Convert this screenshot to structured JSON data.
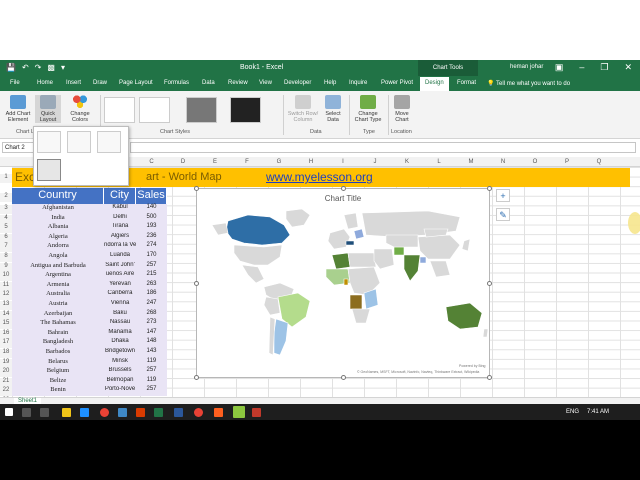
{
  "window": {
    "title": "Book1 - Excel",
    "context_tab": "Chart Tools",
    "user": "heman johar"
  },
  "tabs": [
    "File",
    "Home",
    "Insert",
    "Draw",
    "Page Layout",
    "Formulas",
    "Data",
    "Review",
    "View",
    "Developer",
    "Help",
    "Inquire",
    "Power Pivot",
    "Design",
    "Format"
  ],
  "active_tab": "Design",
  "tell_me": "Tell me what you want to do",
  "ribbon": {
    "add_chart_element": "Add Chart Element",
    "quick_layout": "Quick Layout",
    "change_colors": "Change Colors",
    "chart_layouts_group": "Chart La",
    "chart_styles_group": "Chart Styles",
    "switch_row_col": "Switch Row/ Column",
    "select_data": "Select Data",
    "data_group": "Data",
    "change_chart_type": "Change Chart Type",
    "type_group": "Type",
    "move_chart": "Move Chart",
    "location_group": "Location"
  },
  "name_box": "Chart 2",
  "columns": [
    "A",
    "B",
    "C",
    "D",
    "E",
    "F",
    "G",
    "H",
    "I",
    "J",
    "K",
    "L",
    "M",
    "N",
    "O",
    "P",
    "Q"
  ],
  "rows": [
    "1",
    "2",
    "3",
    "4",
    "5",
    "6",
    "7",
    "8",
    "9",
    "10",
    "11",
    "12",
    "13",
    "14",
    "15",
    "16",
    "17",
    "18",
    "19",
    "20",
    "21",
    "22",
    "23"
  ],
  "banner": {
    "text_left": "Exc",
    "text_right": "art - World Map",
    "link": "www.myelesson.org"
  },
  "table": {
    "headers": [
      "Country",
      "City",
      "Sales"
    ],
    "rows": [
      [
        "Afghanistan",
        "Kabul",
        "140"
      ],
      [
        "India",
        "Delhi",
        "500"
      ],
      [
        "Albania",
        "Tirana",
        "193"
      ],
      [
        "Algeria",
        "Algiers",
        "236"
      ],
      [
        "Andorra",
        "ndorra la Ve",
        "274"
      ],
      [
        "Angola",
        "Luanda",
        "170"
      ],
      [
        "Antigua and Barbuda",
        "Saint John'",
        "257"
      ],
      [
        "Argentina",
        "uenos Aire",
        "215"
      ],
      [
        "Armenia",
        "Yerevan",
        "263"
      ],
      [
        "Australia",
        "Canberra",
        "186"
      ],
      [
        "Austria",
        "Vienna",
        "247"
      ],
      [
        "Azerbaijan",
        "Baku",
        "268"
      ],
      [
        "The Bahamas",
        "Nassau",
        "273"
      ],
      [
        "Bahrain",
        "Manama",
        "147"
      ],
      [
        "Bangladesh",
        "Dhaka",
        "148"
      ],
      [
        "Barbados",
        "Bridgetown",
        "143"
      ],
      [
        "Belarus",
        "Minsk",
        "119"
      ],
      [
        "Belgium",
        "Brussels",
        "257"
      ],
      [
        "Belize",
        "Belmopan",
        "119"
      ],
      [
        "Benin",
        "Porto-Nove",
        "257"
      ]
    ]
  },
  "chart": {
    "title": "Chart Title",
    "attribution": "© GeoNames, MSFT, Microsoft, Navinfo, Navteq, Thinkware Extract, Wikipedia",
    "powered_by": "Powered by Bing"
  },
  "sheet_tab": "Sheet1",
  "taskbar": {
    "lang": "ENG",
    "time": "7:41 AM"
  },
  "colors": {
    "excel_green": "#217346",
    "banner": "#ffc000",
    "header_blue": "#4472c4",
    "row_fill": "#e9e4f5"
  }
}
